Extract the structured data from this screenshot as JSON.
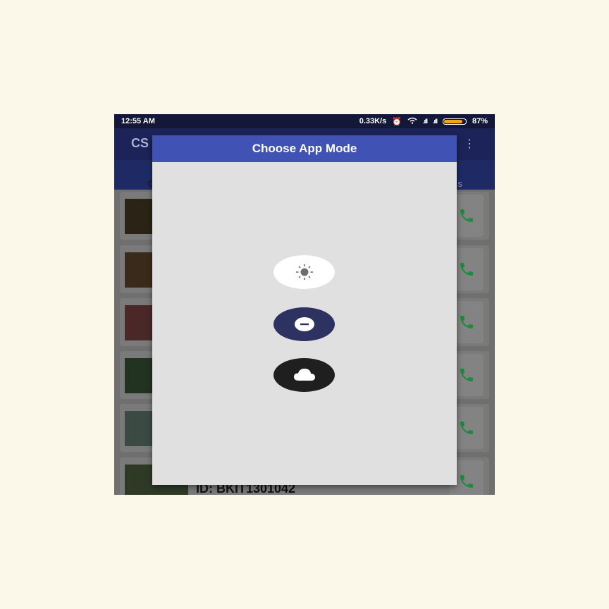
{
  "status": {
    "time": "12:55 AM",
    "speed": "0.33K/s",
    "battery_percent": "87%",
    "battery_level": 0.87,
    "icons": [
      "alarm-icon",
      "wifi-icon",
      "signal-icon",
      "signal-icon",
      "battery-icon"
    ]
  },
  "appbar": {
    "title": "CS",
    "menu_icon": "more-vert-icon"
  },
  "tabs": {
    "left_partial": "C",
    "right_partial": "s"
  },
  "list": {
    "items": [
      {
        "thumb": "photo"
      },
      {
        "thumb": "photo"
      },
      {
        "thumb": "photo"
      },
      {
        "thumb": "photo"
      },
      {
        "thumb": "photo"
      },
      {
        "thumb": "photo",
        "text": "ID: BKIT1301042"
      }
    ],
    "call_icon": "phone-icon",
    "call_color": "#1e8a3c"
  },
  "dialog": {
    "title": "Choose App Mode",
    "modes": [
      {
        "name": "light",
        "icon": "sun-icon",
        "bg": "#ffffff"
      },
      {
        "name": "dim",
        "icon": "minus-circle-icon",
        "bg": "#2d3261"
      },
      {
        "name": "dark",
        "icon": "cloud-icon",
        "bg": "#1f1f1f"
      }
    ],
    "header_color": "#4152b5"
  }
}
